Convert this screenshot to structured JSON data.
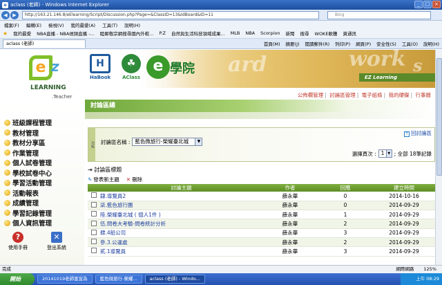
{
  "browser": {
    "title": "aclass (老師) - Windows Internet Explorer",
    "address": "http://163.21.146.8/eElearning/Script/Discussion.php?Page=&ClassID=13&IdBoard&ID=11",
    "search_placeholder": "Bing",
    "menu": [
      "檔案(F)",
      "編輯(E)",
      "檢視(V)",
      "我的最愛(A)",
      "工具(T)",
      "說明(H)"
    ],
    "favorites": [
      "我的最愛",
      "NBA直播 - NBA視頻直播 -...",
      "睦鄰敬宗網搜尋國內外較...",
      "P.Z",
      "自然與生活科技領域成果...",
      "MLB",
      "NBA",
      "Scorpion",
      "新聞",
      "搜尋",
      "WOKE軟體",
      "資通訊"
    ],
    "tab": "aclass (老師)",
    "commands": [
      "首頁(M)",
      "摘要(J)",
      "閱讀郵件(R)",
      "列印(P)",
      "網頁(P)",
      "安全性(S)",
      "工具(O)",
      "說明(H)"
    ]
  },
  "banner": {
    "habook": "HaBook",
    "aclass": "AClass",
    "elearn_title": "學院",
    "ez_learning": "EZ Learning",
    "learning": "LEARNING",
    "teacher": ".Teacher",
    "deco_words": [
      "ard",
      "work",
      "s"
    ]
  },
  "top_links": [
    "公佈欄管理",
    "討論區管理",
    "電子紙條",
    "我的硬碟",
    "行事曆"
  ],
  "sidebar": {
    "items": [
      "班級課程管理",
      "教材管理",
      "教材分享區",
      "作業管理",
      "個人試卷管理",
      "學校試卷中心",
      "學習活動管理",
      "活動報表",
      "成績管理",
      "學習記錄管理",
      "個人資訊管理"
    ],
    "help": "使用手冊",
    "logout": "登出系統"
  },
  "page": {
    "title": "討論區總",
    "panel_side": "功能",
    "back": "回討論區",
    "field_label": "討論區名稱 :",
    "board_selected": "藍色微旅行-榮耀臺北城",
    "pager_label": "選擇頁次 :",
    "page_selected": "1",
    "pager_info": "; 全部 18筆記錄",
    "subhead": "討論區標題",
    "new_topic": "發表新主題",
    "delete": "刪除"
  },
  "table": {
    "headers": [
      "討論主題",
      "作者",
      "回應",
      "建立時間"
    ],
    "rows": [
      {
        "topic": "隸.導覽員2",
        "author": "薛永華",
        "replies": "0",
        "date": "2014-10-16"
      },
      {
        "topic": "柒.藍色旅行團",
        "author": "薛永華",
        "replies": "0",
        "date": "2014-09-29"
      },
      {
        "topic": "陸.榮耀臺北城 ( 個人1件 )",
        "author": "薛永華",
        "replies": "1",
        "date": "2014-09-29"
      },
      {
        "topic": "伍.問卷大考驗-問卷統計分析",
        "author": "薛永華",
        "replies": "2",
        "date": "2014-09-29"
      },
      {
        "topic": "肆.4船公司",
        "author": "薛永華",
        "replies": "3",
        "date": "2014-09-29"
      },
      {
        "topic": "參.3.公運處",
        "author": "薛永華",
        "replies": "2",
        "date": "2014-09-29"
      },
      {
        "topic": "貳.1導覽員",
        "author": "薛永華",
        "replies": "3",
        "date": "2014-09-29"
      }
    ]
  },
  "status": {
    "left": "完成",
    "zone": "網際網路",
    "zoom": "125%"
  },
  "taskbar": {
    "start": "開始",
    "items": [
      "20141019老師富宣為",
      "藍色微旅行-榮耀...",
      "aclass (老師) - Windo..."
    ],
    "clock": "上午 08:29"
  }
}
